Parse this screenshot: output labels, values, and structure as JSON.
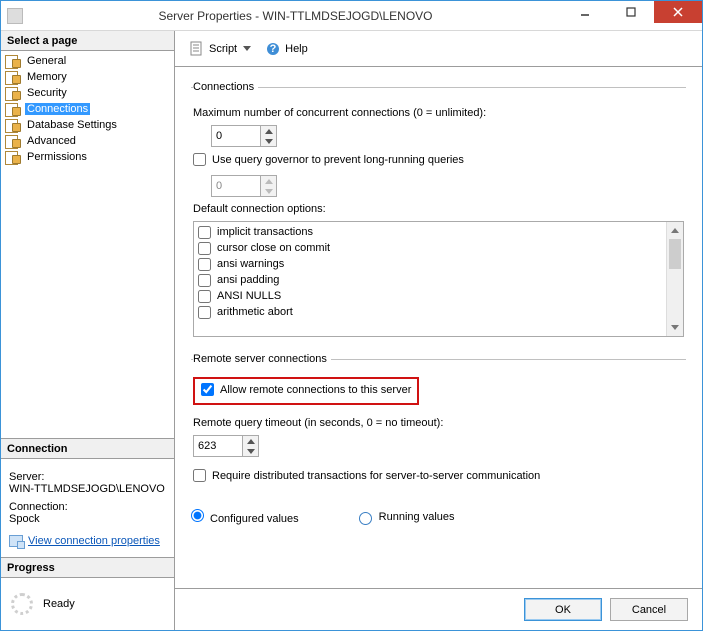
{
  "window": {
    "title": "Server Properties - WIN-TTLMDSEJOGD\\LENOVO"
  },
  "left": {
    "select_page": "Select a page",
    "pages": [
      "General",
      "Memory",
      "Security",
      "Connections",
      "Database Settings",
      "Advanced",
      "Permissions"
    ],
    "selected_index": 3,
    "connection_head": "Connection",
    "server_label": "Server:",
    "server_value": "WIN-TTLMDSEJOGD\\LENOVO",
    "connection_label": "Connection:",
    "connection_value": "Spock",
    "view_props": "View connection properties",
    "progress_head": "Progress",
    "progress_status": "Ready"
  },
  "toolbar": {
    "script": "Script",
    "help": "Help"
  },
  "conn_group": {
    "legend": "Connections",
    "max_label": "Maximum number of concurrent connections (0 = unlimited):",
    "max_value": "0",
    "governor_label": "Use query governor to prevent long-running queries",
    "governor_checked": false,
    "governor_value": "0",
    "options_label": "Default connection options:",
    "options": [
      "implicit transactions",
      "cursor close on commit",
      "ansi warnings",
      "ansi padding",
      "ANSI NULLS",
      "arithmetic abort"
    ]
  },
  "remote_group": {
    "legend": "Remote server connections",
    "allow_label": "Allow remote connections to this server",
    "allow_checked": true,
    "timeout_label": "Remote query timeout (in seconds, 0 = no timeout):",
    "timeout_value": "623",
    "dtc_label": "Require distributed transactions for server-to-server communication",
    "dtc_checked": false
  },
  "values_mode": {
    "configured": "Configured values",
    "running": "Running values",
    "selected": "configured"
  },
  "footer": {
    "ok": "OK",
    "cancel": "Cancel"
  }
}
